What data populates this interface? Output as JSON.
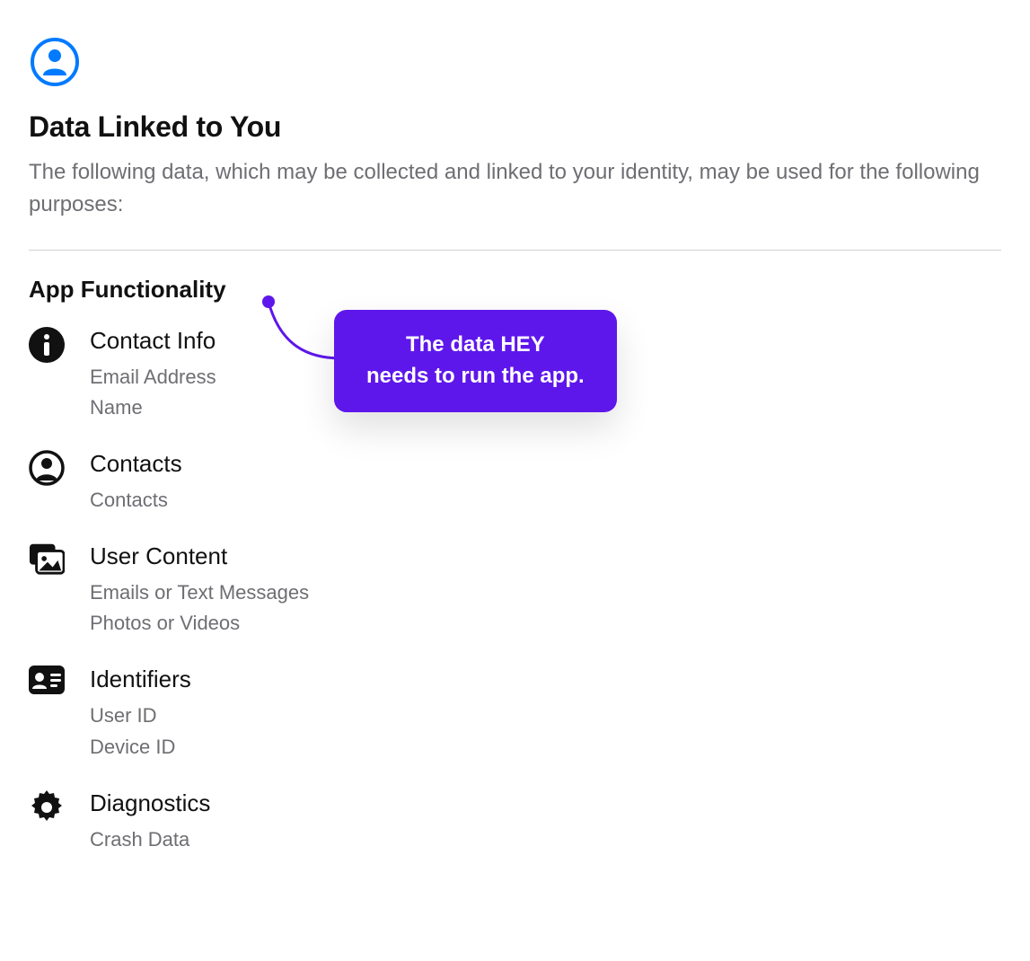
{
  "header": {
    "title": "Data Linked to You",
    "description": "The following data, which may be collected and linked to your identity, may be used for the following purposes:"
  },
  "section": {
    "title": "App Functionality"
  },
  "callout": {
    "line1": "The data HEY",
    "line2": "needs to run the app.",
    "color": "#5e17eb"
  },
  "items": [
    {
      "icon": "info-icon",
      "title": "Contact Info",
      "subs": [
        "Email Address",
        "Name"
      ]
    },
    {
      "icon": "contacts-icon",
      "title": "Contacts",
      "subs": [
        "Contacts"
      ]
    },
    {
      "icon": "photos-icon",
      "title": "User Content",
      "subs": [
        "Emails or Text Messages",
        "Photos or Videos"
      ]
    },
    {
      "icon": "id-card-icon",
      "title": "Identifiers",
      "subs": [
        "User ID",
        "Device ID"
      ]
    },
    {
      "icon": "gear-icon",
      "title": "Diagnostics",
      "subs": [
        "Crash Data"
      ]
    }
  ]
}
